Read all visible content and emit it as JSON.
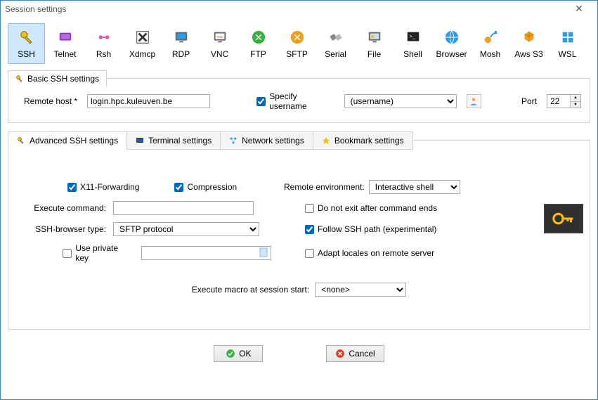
{
  "window": {
    "title": "Session settings"
  },
  "toolbar": [
    {
      "label": "SSH",
      "icon": "key"
    },
    {
      "label": "Telnet",
      "icon": "telnet"
    },
    {
      "label": "Rsh",
      "icon": "rsh"
    },
    {
      "label": "Xdmcp",
      "icon": "xdmcp"
    },
    {
      "label": "RDP",
      "icon": "rdp"
    },
    {
      "label": "VNC",
      "icon": "vnc"
    },
    {
      "label": "FTP",
      "icon": "ftp"
    },
    {
      "label": "SFTP",
      "icon": "sftp"
    },
    {
      "label": "Serial",
      "icon": "serial"
    },
    {
      "label": "File",
      "icon": "file"
    },
    {
      "label": "Shell",
      "icon": "shell"
    },
    {
      "label": "Browser",
      "icon": "browser"
    },
    {
      "label": "Mosh",
      "icon": "mosh"
    },
    {
      "label": "Aws S3",
      "icon": "aws"
    },
    {
      "label": "WSL",
      "icon": "wsl"
    }
  ],
  "basic": {
    "legend": "Basic SSH settings",
    "remote_host_label": "Remote host *",
    "remote_host_value": "login.hpc.kuleuven.be",
    "specify_username_label": "Specify username",
    "specify_username_checked": true,
    "username_value": "(username)",
    "port_label": "Port",
    "port_value": "22"
  },
  "tabs": {
    "advanced": "Advanced SSH settings",
    "terminal": "Terminal settings",
    "network": "Network settings",
    "bookmark": "Bookmark settings"
  },
  "advanced": {
    "x11_label": "X11-Forwarding",
    "x11_checked": true,
    "compression_label": "Compression",
    "compression_checked": true,
    "remote_env_label": "Remote environment:",
    "remote_env_value": "Interactive shell",
    "exec_cmd_label": "Execute command:",
    "exec_cmd_value": "",
    "do_not_exit_label": "Do not exit after command ends",
    "do_not_exit_checked": false,
    "ssh_browser_label": "SSH-browser type:",
    "ssh_browser_value": "SFTP protocol",
    "follow_path_label": "Follow SSH path (experimental)",
    "follow_path_checked": true,
    "private_key_label": "Use private key",
    "private_key_checked": false,
    "adapt_locales_label": "Adapt locales on remote server",
    "adapt_locales_checked": false,
    "macro_label": "Execute macro at session start:",
    "macro_value": "<none>"
  },
  "buttons": {
    "ok": "OK",
    "cancel": "Cancel"
  }
}
